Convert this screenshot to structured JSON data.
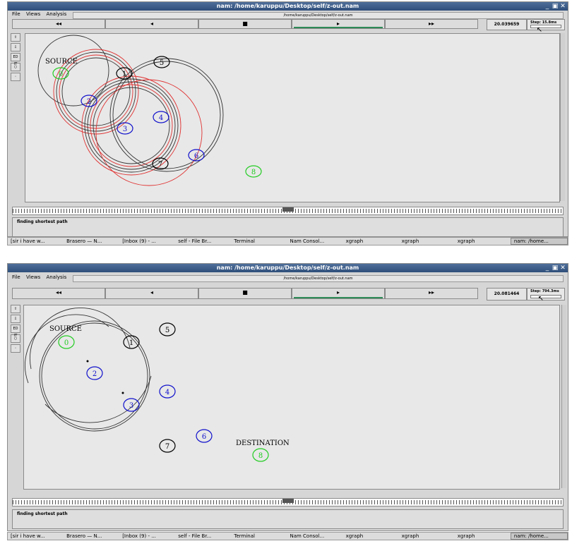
{
  "window": {
    "title": "nam: /home/karuppu/Desktop/self/z-out.nam",
    "path": "/home/karuppu/Desktop/self/z-out.nam",
    "controls": {
      "minimize": "_",
      "maximize": "▣",
      "close": "✕"
    }
  },
  "menu": {
    "file": "File",
    "views": "Views",
    "analysis": "Analysis"
  },
  "playback": {
    "rewind": "◂◂",
    "back": "◂",
    "stop": "■",
    "play": "▸",
    "fast_forward": "▸▸"
  },
  "tools": {
    "edit": "ED IT"
  },
  "top": {
    "time": "20.039659",
    "step": "Step: 15.8ms",
    "status": "finding shortest path",
    "timeline_marker": "nam"
  },
  "bottom": {
    "time": "20.081464",
    "step": "Step: 794.3ms",
    "status": "finding shortest path",
    "timeline_marker": "nam"
  },
  "labels": {
    "source": "SOURCE",
    "destination": "DESTINATION"
  },
  "nodes": [
    "0",
    "1",
    "2",
    "3",
    "4",
    "5",
    "6",
    "7",
    "8"
  ],
  "taskbar_top": [
    "[sir i have w...",
    "Brasero — N...",
    "[Inbox (9) - ...",
    "self - File Br...",
    "Terminal",
    "Nam Consol...",
    "xgraph",
    "xgraph",
    "xgraph",
    "nam: /home..."
  ],
  "taskbar_bottom": [
    "[sir i have w...",
    "Brasero — N...",
    "[Inbox (9) - ...",
    "self - File Br...",
    "Terminal",
    "Nam Consol...",
    "xgraph",
    "xgraph",
    "xgraph",
    "nam: /home..."
  ],
  "colors": {
    "source_node": "#22cc22",
    "relay_node": "#1010cc",
    "idle_node": "#000000",
    "wave": "#e03030"
  }
}
